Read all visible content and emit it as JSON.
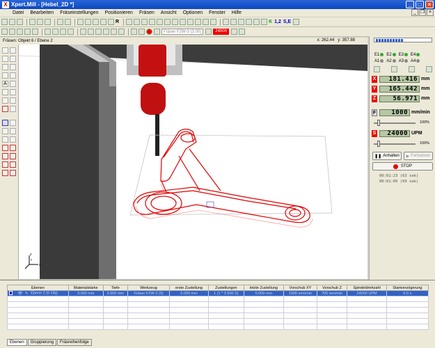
{
  "window": {
    "title": "Xpert.Mill - [Hebel_2D *]"
  },
  "menu": [
    "Datei",
    "Bearbeiten",
    "Fräseinstellungen",
    "Positionieren",
    "Fräsen",
    "Ansicht",
    "Optionen",
    "Fenster",
    "Hilfe"
  ],
  "toolbar": {
    "tool_dropdown": "Fräser F2W-3 (3.00)",
    "speed_value": "24000",
    "labels": [
      "R",
      "1,2",
      "S,E"
    ]
  },
  "statusline": {
    "object": "Fräsen: Objekt 6 / Ebene 2",
    "x": "262.44",
    "y": "357.88"
  },
  "right_panel": {
    "row1": [
      "E1",
      "E2",
      "E3",
      "E4"
    ],
    "row2": [
      "A1",
      "A2",
      "A3",
      "A4"
    ],
    "axes": [
      {
        "label": "X",
        "value": "181.416",
        "unit": "mm"
      },
      {
        "label": "Y",
        "value": "165.442",
        "unit": "mm"
      },
      {
        "label": "Z",
        "value": "56.971",
        "unit": "mm"
      }
    ],
    "feed": {
      "label": "F",
      "value": "1000",
      "unit": "mm/min",
      "percent": "100%"
    },
    "spindle": {
      "label": "S",
      "value": "24000",
      "unit": "UPM",
      "percent": "100%"
    },
    "hold_button": "Anhalten",
    "continue_button": "Fortsetzen",
    "stop_button": "STOP",
    "elapsed": "00:01:23 (63 sek)",
    "remaining": "00:01:09 (69 sek)"
  },
  "layers_table": {
    "headers": [
      "Ebenen",
      "Materialstärke",
      "Tiefe",
      "Werkzeug",
      "erste Zustellung",
      "Zustellungen",
      "letzte Zustellung",
      "Vorschub XY",
      "Vorschub Z",
      "Spindeldrehzahl",
      "Startverzögerung"
    ],
    "rows": [
      [
        "Ebene 2 (6 Obj)",
        "3.000 mm",
        "3.500 mm",
        "Fräser F2W-3 (3)",
        "0.000 mm",
        "1 (1 * 3.500 S)",
        "0.000 mm",
        "1000 mm/min",
        "700 mm/min",
        "24000 UPM",
        "0.0 s"
      ]
    ]
  },
  "tabs": [
    "Ebenen",
    "Gruppierung",
    "Fräsreihenfolge"
  ],
  "colors": {
    "accent_red": "#e00000",
    "lcd_bg": "#b6c7a6",
    "title_blue": "#0a46c0"
  }
}
